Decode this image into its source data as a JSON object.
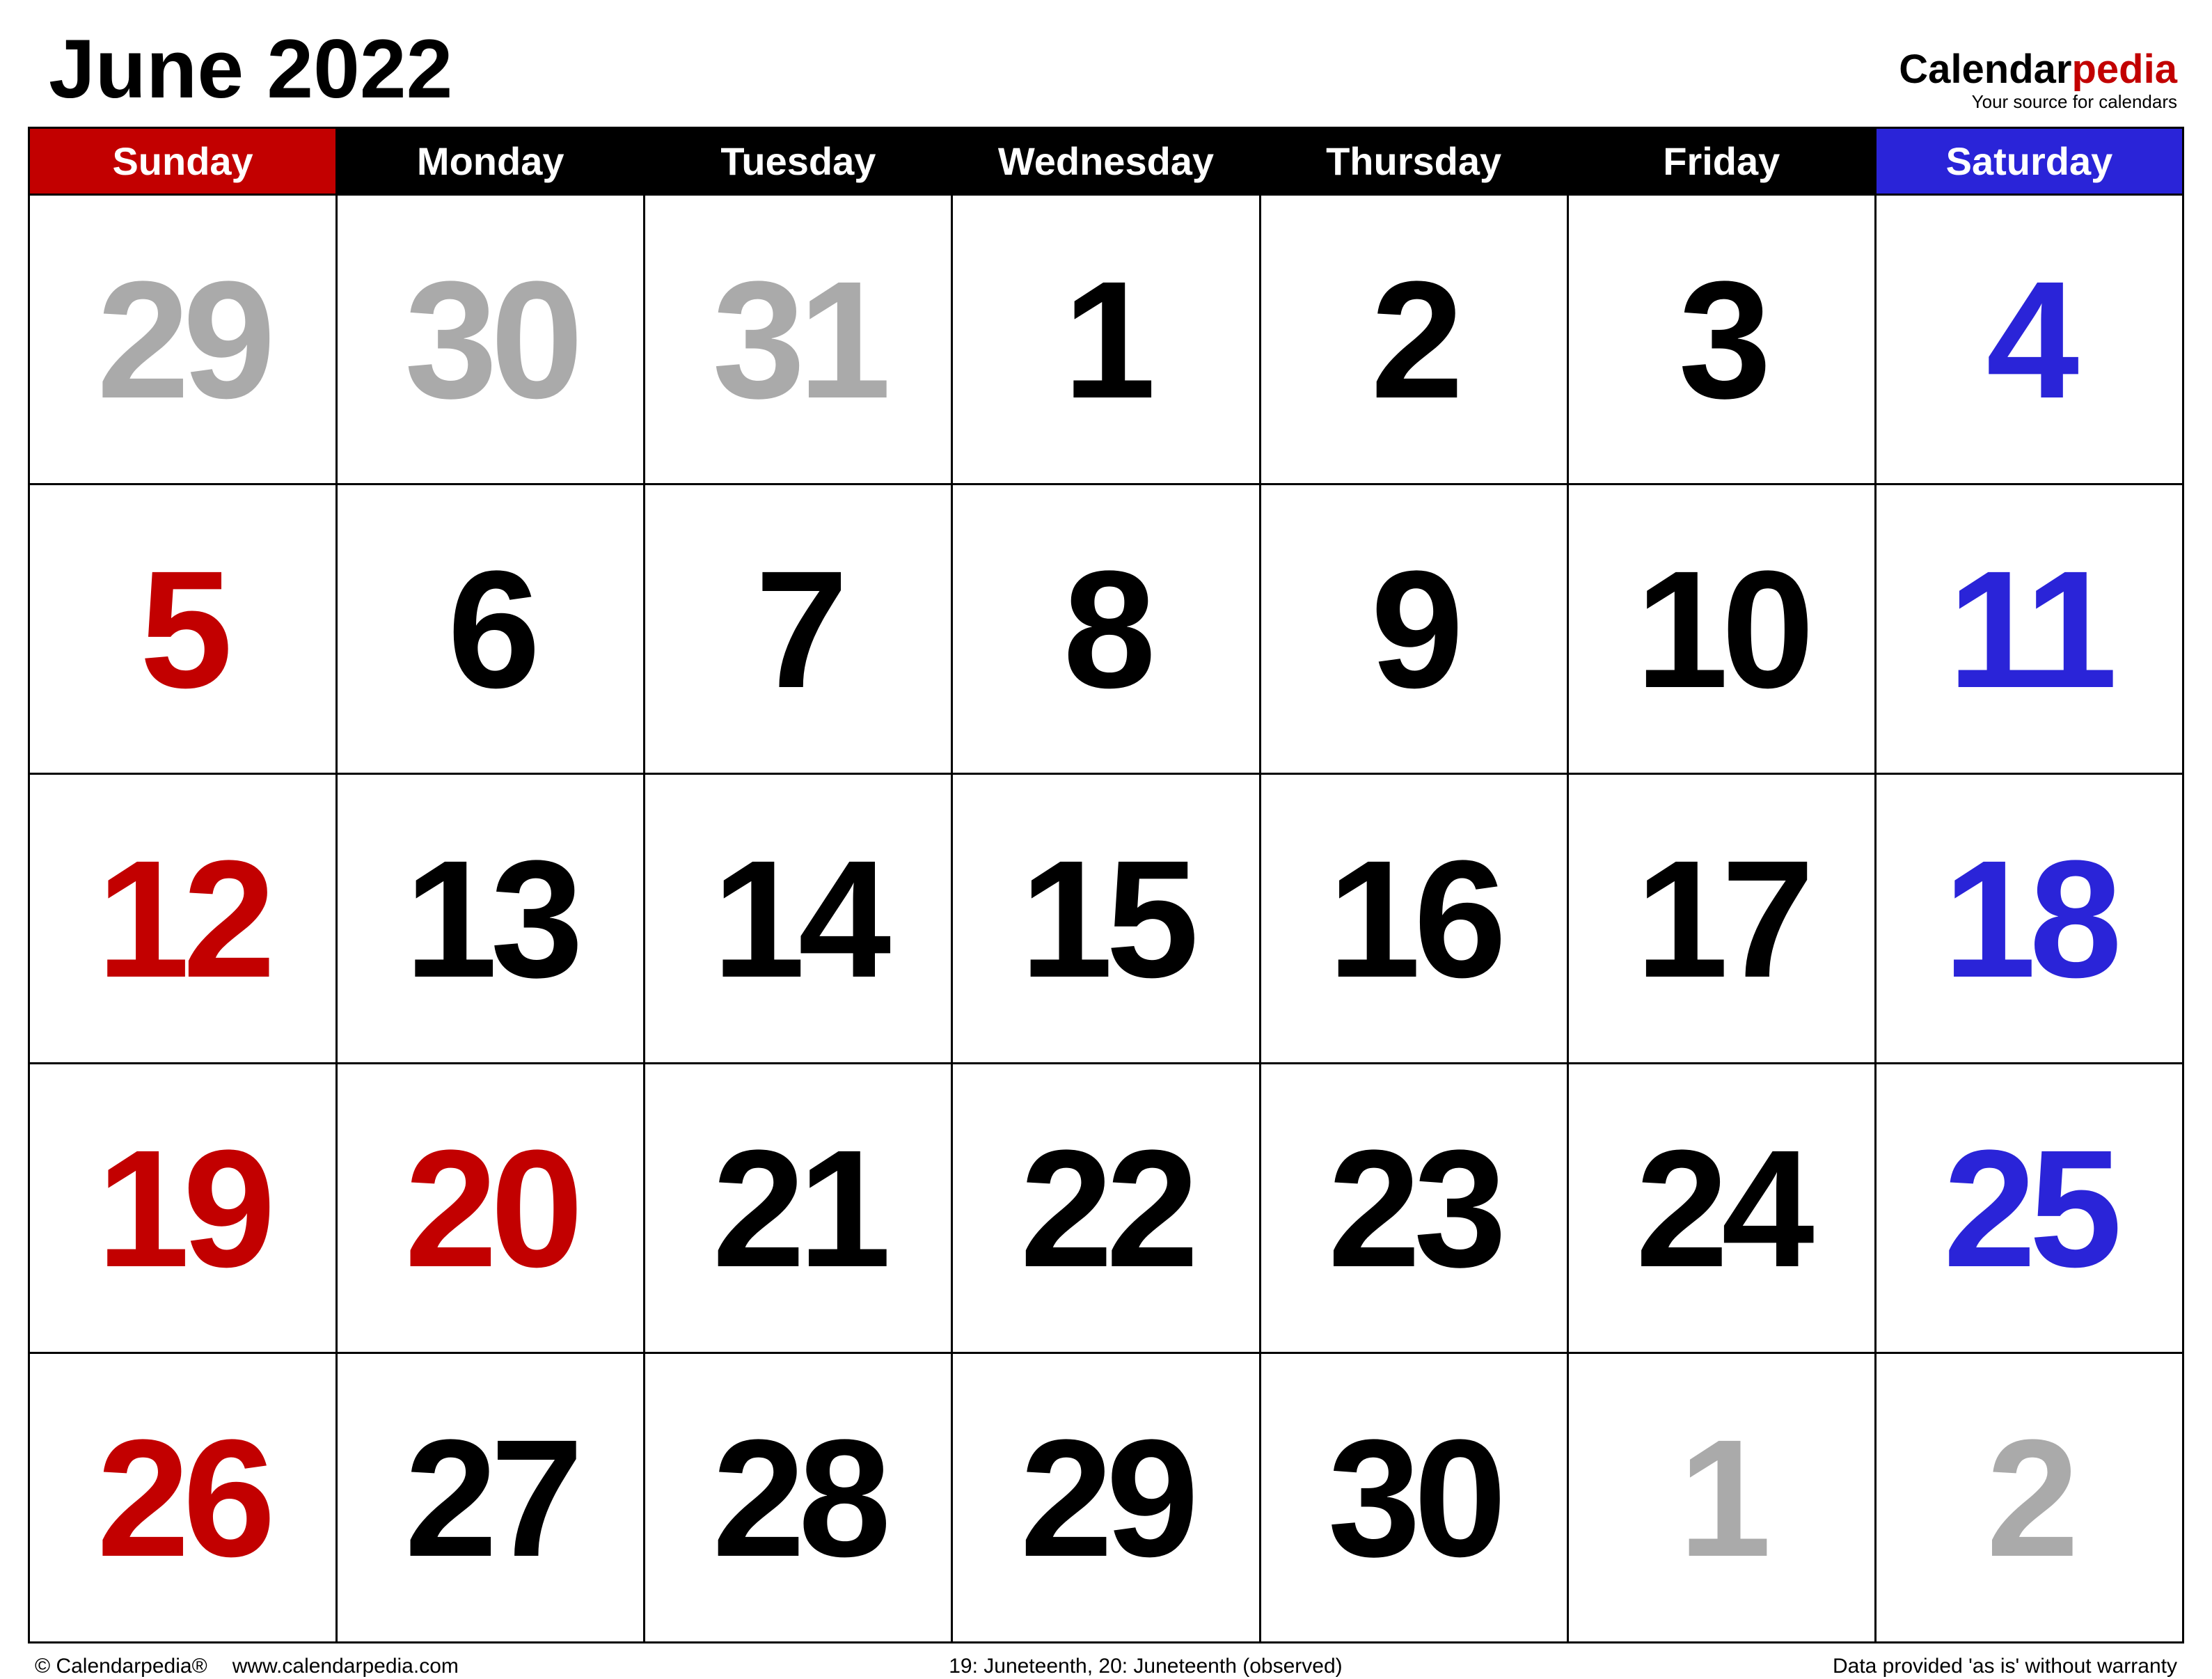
{
  "header": {
    "title": "June 2022",
    "brand_part1": "Calendar",
    "brand_part2": "pedia",
    "brand_tagline": "Your source for calendars"
  },
  "weekdays": {
    "sun": "Sunday",
    "mon": "Monday",
    "tue": "Tuesday",
    "wed": "Wednesday",
    "thu": "Thursday",
    "fri": "Friday",
    "sat": "Saturday"
  },
  "weeks": [
    [
      {
        "n": "29",
        "cls": "other"
      },
      {
        "n": "30",
        "cls": "other"
      },
      {
        "n": "31",
        "cls": "other"
      },
      {
        "n": "1",
        "cls": "day"
      },
      {
        "n": "2",
        "cls": "day"
      },
      {
        "n": "3",
        "cls": "day"
      },
      {
        "n": "4",
        "cls": "sat"
      }
    ],
    [
      {
        "n": "5",
        "cls": "sun"
      },
      {
        "n": "6",
        "cls": "day"
      },
      {
        "n": "7",
        "cls": "day"
      },
      {
        "n": "8",
        "cls": "day"
      },
      {
        "n": "9",
        "cls": "day"
      },
      {
        "n": "10",
        "cls": "day"
      },
      {
        "n": "11",
        "cls": "sat"
      }
    ],
    [
      {
        "n": "12",
        "cls": "sun"
      },
      {
        "n": "13",
        "cls": "day"
      },
      {
        "n": "14",
        "cls": "day"
      },
      {
        "n": "15",
        "cls": "day"
      },
      {
        "n": "16",
        "cls": "day"
      },
      {
        "n": "17",
        "cls": "day"
      },
      {
        "n": "18",
        "cls": "sat"
      }
    ],
    [
      {
        "n": "19",
        "cls": "sun"
      },
      {
        "n": "20",
        "cls": "holiday"
      },
      {
        "n": "21",
        "cls": "day"
      },
      {
        "n": "22",
        "cls": "day"
      },
      {
        "n": "23",
        "cls": "day"
      },
      {
        "n": "24",
        "cls": "day"
      },
      {
        "n": "25",
        "cls": "sat"
      }
    ],
    [
      {
        "n": "26",
        "cls": "sun"
      },
      {
        "n": "27",
        "cls": "day"
      },
      {
        "n": "28",
        "cls": "day"
      },
      {
        "n": "29",
        "cls": "day"
      },
      {
        "n": "30",
        "cls": "day"
      },
      {
        "n": "1",
        "cls": "other"
      },
      {
        "n": "2",
        "cls": "other"
      }
    ]
  ],
  "footer": {
    "copyright": "© Calendarpedia®",
    "url": "www.calendarpedia.com",
    "holidays": "19: Juneteenth, 20: Juneteenth (observed)",
    "disclaimer": "Data provided 'as is' without warranty"
  }
}
